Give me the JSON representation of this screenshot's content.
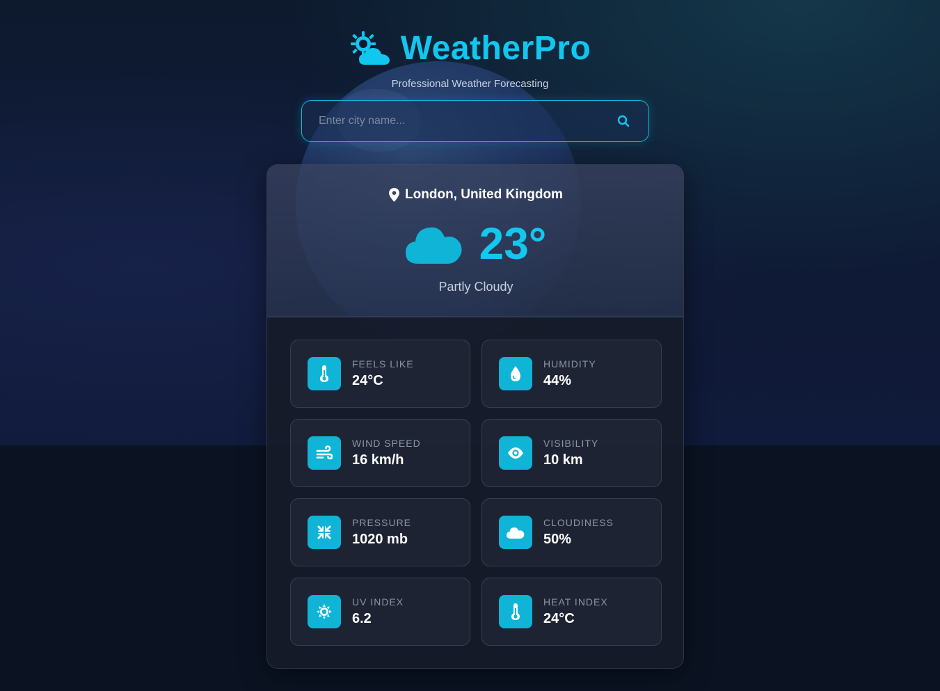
{
  "app": {
    "title": "WeatherPro",
    "subtitle": "Professional Weather Forecasting",
    "accent_color": "#11c7ef",
    "logo_icon": "sun-cloud-icon"
  },
  "search": {
    "placeholder": "Enter city name...",
    "value": "",
    "button_icon": "search-icon"
  },
  "current": {
    "location": "London, United Kingdom",
    "location_icon": "map-pin-icon",
    "weather_icon": "cloud-icon",
    "temperature": "23°",
    "condition": "Partly Cloudy"
  },
  "stats": [
    {
      "label": "FEELS LIKE",
      "value": "24°C",
      "icon": "thermometer-icon"
    },
    {
      "label": "HUMIDITY",
      "value": "44%",
      "icon": "droplet-icon"
    },
    {
      "label": "WIND SPEED",
      "value": "16 km/h",
      "icon": "wind-icon"
    },
    {
      "label": "VISIBILITY",
      "value": "10 km",
      "icon": "eye-icon"
    },
    {
      "label": "PRESSURE",
      "value": "1020 mb",
      "icon": "compress-icon"
    },
    {
      "label": "CLOUDINESS",
      "value": "50%",
      "icon": "cloud-icon"
    },
    {
      "label": "UV INDEX",
      "value": "6.2",
      "icon": "sun-icon"
    },
    {
      "label": "HEAT INDEX",
      "value": "24°C",
      "icon": "thermometer-icon"
    }
  ]
}
